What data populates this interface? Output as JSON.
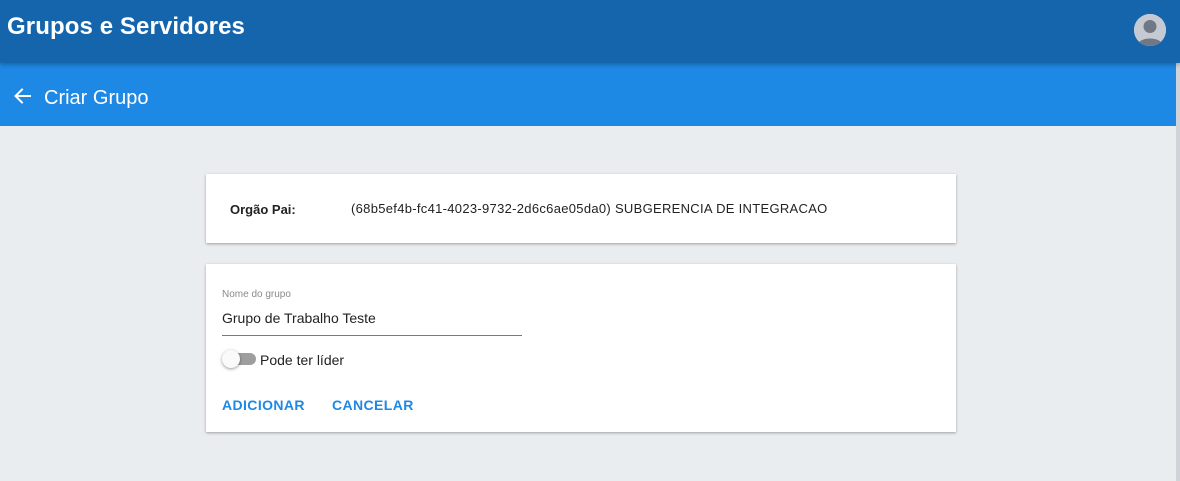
{
  "header": {
    "app_title": "Grupos e Servidores",
    "avatar_icon": "user-avatar-icon"
  },
  "subheader": {
    "back_icon": "arrow-left-icon",
    "title": "Criar Grupo"
  },
  "parent_card": {
    "label": "Orgão Pai:",
    "value": "(68b5ef4b-fc41-4023-9732-2d6c6ae05da0) SUBGERENCIA DE INTEGRACAO"
  },
  "form": {
    "name_label": "Nome do grupo",
    "name_value": "Grupo de Trabalho Teste",
    "leader_toggle_label": "Pode ter líder",
    "leader_toggle_on": false,
    "add_label": "ADICIONAR",
    "cancel_label": "CANCELAR"
  },
  "colors": {
    "topbar": "#1565ad",
    "subbar": "#1e88e5",
    "accent": "#1e88e5",
    "background": "#eaedf0"
  }
}
